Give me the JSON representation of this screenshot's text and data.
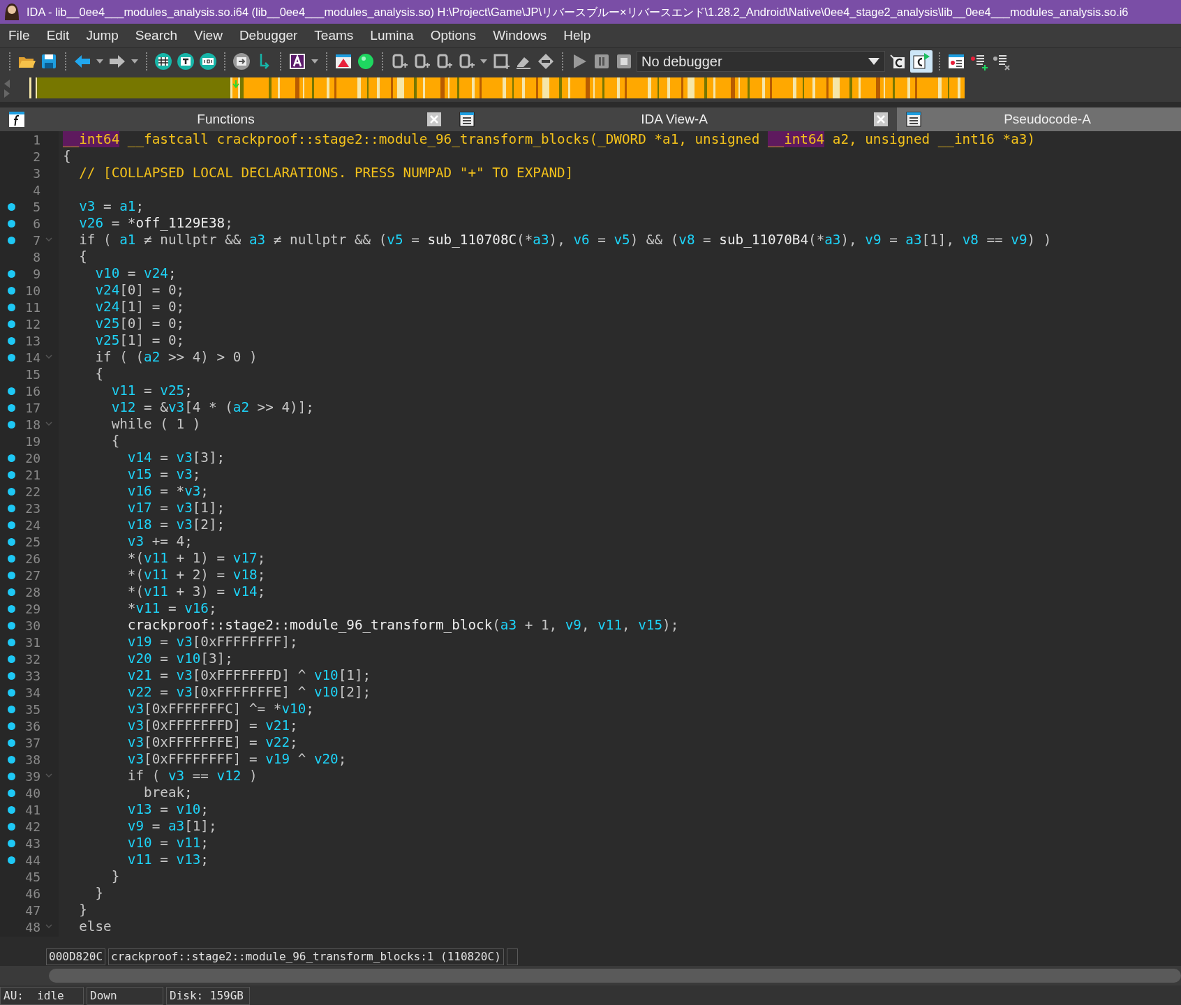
{
  "window": {
    "title": "IDA - lib__0ee4___modules_analysis.so.i64 (lib__0ee4___modules_analysis.so) H:\\Project\\Game\\JP\\リバースブルー×リバースエンド\\1.28.2_Android\\Native\\0ee4_stage2_analysis\\lib__0ee4___modules_analysis.so.i6"
  },
  "menu": [
    "File",
    "Edit",
    "Jump",
    "Search",
    "View",
    "Debugger",
    "Teams",
    "Lumina",
    "Options",
    "Windows",
    "Help"
  ],
  "toolbar": {
    "debugger_select": "No debugger",
    "sync_on": true
  },
  "tabs": [
    {
      "label": "Functions",
      "selected": false,
      "closable": true
    },
    {
      "label": "IDA View-A",
      "selected": false,
      "closable": true
    },
    {
      "label": "Pseudocode-A",
      "selected": true,
      "closable": false
    }
  ],
  "lines": [
    {
      "number": "1",
      "marker": false,
      "foldable": false,
      "tokens": [
        {
          "kind": "highlight",
          "text": "__int64"
        },
        {
          "kind": "decl",
          "text": " __fastcall crackproof::stage2::module_96_transform_blocks(_DWORD *a1, unsigned "
        },
        {
          "kind": "highlight",
          "text": "__int64"
        },
        {
          "kind": "decl",
          "text": " a2, unsigned __int16 *a3)"
        }
      ]
    },
    {
      "number": "2",
      "marker": false,
      "foldable": false,
      "tokens": [
        {
          "kind": "plain",
          "text": "{"
        }
      ]
    },
    {
      "number": "3",
      "marker": false,
      "foldable": false,
      "tokens": [
        {
          "kind": "decl",
          "text": "  // [COLLAPSED LOCAL DECLARATIONS. PRESS NUMPAD \"+\" TO EXPAND]"
        }
      ]
    },
    {
      "number": "4",
      "marker": false,
      "foldable": false
    },
    {
      "number": "5",
      "marker": true,
      "foldable": false,
      "tokens": [
        {
          "kind": "var",
          "text": "  v3"
        },
        {
          "kind": "plain",
          "text": " = "
        },
        {
          "kind": "var",
          "text": "a1"
        },
        {
          "kind": "plain",
          "text": ";"
        }
      ]
    },
    {
      "number": "6",
      "marker": true,
      "foldable": false,
      "tokens": [
        {
          "kind": "var",
          "text": "  v26"
        },
        {
          "kind": "plain",
          "text": " = *"
        },
        {
          "kind": "name",
          "text": "off_1129E38"
        },
        {
          "kind": "plain",
          "text": ";"
        }
      ]
    },
    {
      "number": "7",
      "marker": true,
      "foldable": true,
      "tokens": [
        {
          "kind": "plain",
          "text": "  if ( "
        },
        {
          "kind": "var",
          "text": "a1"
        },
        {
          "kind": "plain",
          "text": " ≠ nullptr && "
        },
        {
          "kind": "var",
          "text": "a3"
        },
        {
          "kind": "plain",
          "text": " ≠ nullptr && ("
        },
        {
          "kind": "var",
          "text": "v5"
        },
        {
          "kind": "plain",
          "text": " = "
        },
        {
          "kind": "name",
          "text": "sub_110708C"
        },
        {
          "kind": "plain",
          "text": "(*"
        },
        {
          "kind": "var",
          "text": "a3"
        },
        {
          "kind": "plain",
          "text": "), "
        },
        {
          "kind": "var",
          "text": "v6"
        },
        {
          "kind": "plain",
          "text": " = "
        },
        {
          "kind": "var",
          "text": "v5"
        },
        {
          "kind": "plain",
          "text": ") && ("
        },
        {
          "kind": "var",
          "text": "v8"
        },
        {
          "kind": "plain",
          "text": " = "
        },
        {
          "kind": "name",
          "text": "sub_11070B4"
        },
        {
          "kind": "plain",
          "text": "(*"
        },
        {
          "kind": "var",
          "text": "a3"
        },
        {
          "kind": "plain",
          "text": "), "
        },
        {
          "kind": "var",
          "text": "v9"
        },
        {
          "kind": "plain",
          "text": " = "
        },
        {
          "kind": "var",
          "text": "a3"
        },
        {
          "kind": "plain",
          "text": "[1], "
        },
        {
          "kind": "var",
          "text": "v8"
        },
        {
          "kind": "plain",
          "text": " == "
        },
        {
          "kind": "var",
          "text": "v9"
        },
        {
          "kind": "plain",
          "text": ") )"
        }
      ]
    },
    {
      "number": "8",
      "marker": false,
      "foldable": false,
      "tokens": [
        {
          "kind": "plain",
          "text": "  {"
        }
      ]
    },
    {
      "number": "9",
      "marker": true,
      "foldable": false,
      "tokens": [
        {
          "kind": "var",
          "text": "    v10"
        },
        {
          "kind": "plain",
          "text": " = "
        },
        {
          "kind": "var",
          "text": "v24"
        },
        {
          "kind": "plain",
          "text": ";"
        }
      ]
    },
    {
      "number": "10",
      "marker": true,
      "foldable": false,
      "tokens": [
        {
          "kind": "var",
          "text": "    v24"
        },
        {
          "kind": "plain",
          "text": "[0] = 0;"
        }
      ]
    },
    {
      "number": "11",
      "marker": true,
      "foldable": false,
      "tokens": [
        {
          "kind": "var",
          "text": "    v24"
        },
        {
          "kind": "plain",
          "text": "[1] = 0;"
        }
      ]
    },
    {
      "number": "12",
      "marker": true,
      "foldable": false,
      "tokens": [
        {
          "kind": "var",
          "text": "    v25"
        },
        {
          "kind": "plain",
          "text": "[0] = 0;"
        }
      ]
    },
    {
      "number": "13",
      "marker": true,
      "foldable": false,
      "tokens": [
        {
          "kind": "var",
          "text": "    v25"
        },
        {
          "kind": "plain",
          "text": "[1] = 0;"
        }
      ]
    },
    {
      "number": "14",
      "marker": true,
      "foldable": true,
      "tokens": [
        {
          "kind": "plain",
          "text": "    if ( ("
        },
        {
          "kind": "var",
          "text": "a2"
        },
        {
          "kind": "plain",
          "text": " >> 4) > 0 )"
        }
      ]
    },
    {
      "number": "15",
      "marker": false,
      "foldable": false,
      "tokens": [
        {
          "kind": "plain",
          "text": "    {"
        }
      ]
    },
    {
      "number": "16",
      "marker": true,
      "foldable": false,
      "tokens": [
        {
          "kind": "var",
          "text": "      v11"
        },
        {
          "kind": "plain",
          "text": " = "
        },
        {
          "kind": "var",
          "text": "v25"
        },
        {
          "kind": "plain",
          "text": ";"
        }
      ]
    },
    {
      "number": "17",
      "marker": true,
      "foldable": false,
      "tokens": [
        {
          "kind": "var",
          "text": "      v12"
        },
        {
          "kind": "plain",
          "text": " = &"
        },
        {
          "kind": "var",
          "text": "v3"
        },
        {
          "kind": "plain",
          "text": "[4 * ("
        },
        {
          "kind": "var",
          "text": "a2"
        },
        {
          "kind": "plain",
          "text": " >> 4)];"
        }
      ]
    },
    {
      "number": "18",
      "marker": true,
      "foldable": true,
      "tokens": [
        {
          "kind": "plain",
          "text": "      while ( 1 )"
        }
      ]
    },
    {
      "number": "19",
      "marker": false,
      "foldable": false,
      "tokens": [
        {
          "kind": "plain",
          "text": "      {"
        }
      ]
    },
    {
      "number": "20",
      "marker": true,
      "foldable": false,
      "tokens": [
        {
          "kind": "var",
          "text": "        v14"
        },
        {
          "kind": "plain",
          "text": " = "
        },
        {
          "kind": "var",
          "text": "v3"
        },
        {
          "kind": "plain",
          "text": "[3];"
        }
      ]
    },
    {
      "number": "21",
      "marker": true,
      "foldable": false,
      "tokens": [
        {
          "kind": "var",
          "text": "        v15"
        },
        {
          "kind": "plain",
          "text": " = "
        },
        {
          "kind": "var",
          "text": "v3"
        },
        {
          "kind": "plain",
          "text": ";"
        }
      ]
    },
    {
      "number": "22",
      "marker": true,
      "foldable": false,
      "tokens": [
        {
          "kind": "var",
          "text": "        v16"
        },
        {
          "kind": "plain",
          "text": " = *"
        },
        {
          "kind": "var",
          "text": "v3"
        },
        {
          "kind": "plain",
          "text": ";"
        }
      ]
    },
    {
      "number": "23",
      "marker": true,
      "foldable": false,
      "tokens": [
        {
          "kind": "var",
          "text": "        v17"
        },
        {
          "kind": "plain",
          "text": " = "
        },
        {
          "kind": "var",
          "text": "v3"
        },
        {
          "kind": "plain",
          "text": "[1];"
        }
      ]
    },
    {
      "number": "24",
      "marker": true,
      "foldable": false,
      "tokens": [
        {
          "kind": "var",
          "text": "        v18"
        },
        {
          "kind": "plain",
          "text": " = "
        },
        {
          "kind": "var",
          "text": "v3"
        },
        {
          "kind": "plain",
          "text": "[2];"
        }
      ]
    },
    {
      "number": "25",
      "marker": true,
      "foldable": false,
      "tokens": [
        {
          "kind": "var",
          "text": "        v3"
        },
        {
          "kind": "plain",
          "text": " += 4;"
        }
      ]
    },
    {
      "number": "26",
      "marker": true,
      "foldable": false,
      "tokens": [
        {
          "kind": "plain",
          "text": "        *("
        },
        {
          "kind": "var",
          "text": "v11"
        },
        {
          "kind": "plain",
          "text": " + 1) = "
        },
        {
          "kind": "var",
          "text": "v17"
        },
        {
          "kind": "plain",
          "text": ";"
        }
      ]
    },
    {
      "number": "27",
      "marker": true,
      "foldable": false,
      "tokens": [
        {
          "kind": "plain",
          "text": "        *("
        },
        {
          "kind": "var",
          "text": "v11"
        },
        {
          "kind": "plain",
          "text": " + 2) = "
        },
        {
          "kind": "var",
          "text": "v18"
        },
        {
          "kind": "plain",
          "text": ";"
        }
      ]
    },
    {
      "number": "28",
      "marker": true,
      "foldable": false,
      "tokens": [
        {
          "kind": "plain",
          "text": "        *("
        },
        {
          "kind": "var",
          "text": "v11"
        },
        {
          "kind": "plain",
          "text": " + 3) = "
        },
        {
          "kind": "var",
          "text": "v14"
        },
        {
          "kind": "plain",
          "text": ";"
        }
      ]
    },
    {
      "number": "29",
      "marker": true,
      "foldable": false,
      "tokens": [
        {
          "kind": "plain",
          "text": "        *"
        },
        {
          "kind": "var",
          "text": "v11"
        },
        {
          "kind": "plain",
          "text": " = "
        },
        {
          "kind": "var",
          "text": "v16"
        },
        {
          "kind": "plain",
          "text": ";"
        }
      ]
    },
    {
      "number": "30",
      "marker": true,
      "foldable": false,
      "tokens": [
        {
          "kind": "name",
          "text": "        crackproof::stage2::module_96_transform_block"
        },
        {
          "kind": "plain",
          "text": "("
        },
        {
          "kind": "var",
          "text": "a3"
        },
        {
          "kind": "plain",
          "text": " + 1, "
        },
        {
          "kind": "var",
          "text": "v9"
        },
        {
          "kind": "plain",
          "text": ", "
        },
        {
          "kind": "var",
          "text": "v11"
        },
        {
          "kind": "plain",
          "text": ", "
        },
        {
          "kind": "var",
          "text": "v15"
        },
        {
          "kind": "plain",
          "text": ");"
        }
      ]
    },
    {
      "number": "31",
      "marker": true,
      "foldable": false,
      "tokens": [
        {
          "kind": "var",
          "text": "        v19"
        },
        {
          "kind": "plain",
          "text": " = "
        },
        {
          "kind": "var",
          "text": "v3"
        },
        {
          "kind": "plain",
          "text": "[0xFFFFFFFF];"
        }
      ]
    },
    {
      "number": "32",
      "marker": true,
      "foldable": false,
      "tokens": [
        {
          "kind": "var",
          "text": "        v20"
        },
        {
          "kind": "plain",
          "text": " = "
        },
        {
          "kind": "var",
          "text": "v10"
        },
        {
          "kind": "plain",
          "text": "[3];"
        }
      ]
    },
    {
      "number": "33",
      "marker": true,
      "foldable": false,
      "tokens": [
        {
          "kind": "var",
          "text": "        v21"
        },
        {
          "kind": "plain",
          "text": " = "
        },
        {
          "kind": "var",
          "text": "v3"
        },
        {
          "kind": "plain",
          "text": "[0xFFFFFFFD] ^ "
        },
        {
          "kind": "var",
          "text": "v10"
        },
        {
          "kind": "plain",
          "text": "[1];"
        }
      ]
    },
    {
      "number": "34",
      "marker": true,
      "foldable": false,
      "tokens": [
        {
          "kind": "var",
          "text": "        v22"
        },
        {
          "kind": "plain",
          "text": " = "
        },
        {
          "kind": "var",
          "text": "v3"
        },
        {
          "kind": "plain",
          "text": "[0xFFFFFFFE] ^ "
        },
        {
          "kind": "var",
          "text": "v10"
        },
        {
          "kind": "plain",
          "text": "[2];"
        }
      ]
    },
    {
      "number": "35",
      "marker": true,
      "foldable": false,
      "tokens": [
        {
          "kind": "var",
          "text": "        v3"
        },
        {
          "kind": "plain",
          "text": "[0xFFFFFFFC] ^= *"
        },
        {
          "kind": "var",
          "text": "v10"
        },
        {
          "kind": "plain",
          "text": ";"
        }
      ]
    },
    {
      "number": "36",
      "marker": true,
      "foldable": false,
      "tokens": [
        {
          "kind": "var",
          "text": "        v3"
        },
        {
          "kind": "plain",
          "text": "[0xFFFFFFFD] = "
        },
        {
          "kind": "var",
          "text": "v21"
        },
        {
          "kind": "plain",
          "text": ";"
        }
      ]
    },
    {
      "number": "37",
      "marker": true,
      "foldable": false,
      "tokens": [
        {
          "kind": "var",
          "text": "        v3"
        },
        {
          "kind": "plain",
          "text": "[0xFFFFFFFE] = "
        },
        {
          "kind": "var",
          "text": "v22"
        },
        {
          "kind": "plain",
          "text": ";"
        }
      ]
    },
    {
      "number": "38",
      "marker": true,
      "foldable": false,
      "tokens": [
        {
          "kind": "var",
          "text": "        v3"
        },
        {
          "kind": "plain",
          "text": "[0xFFFFFFFF] = "
        },
        {
          "kind": "var",
          "text": "v19"
        },
        {
          "kind": "plain",
          "text": " ^ "
        },
        {
          "kind": "var",
          "text": "v20"
        },
        {
          "kind": "plain",
          "text": ";"
        }
      ]
    },
    {
      "number": "39",
      "marker": true,
      "foldable": true,
      "tokens": [
        {
          "kind": "plain",
          "text": "        if ( "
        },
        {
          "kind": "var",
          "text": "v3"
        },
        {
          "kind": "plain",
          "text": " == "
        },
        {
          "kind": "var",
          "text": "v12"
        },
        {
          "kind": "plain",
          "text": " )"
        }
      ]
    },
    {
      "number": "40",
      "marker": true,
      "foldable": false,
      "tokens": [
        {
          "kind": "plain",
          "text": "          break;"
        }
      ]
    },
    {
      "number": "41",
      "marker": true,
      "foldable": false,
      "tokens": [
        {
          "kind": "var",
          "text": "        v13"
        },
        {
          "kind": "plain",
          "text": " = "
        },
        {
          "kind": "var",
          "text": "v10"
        },
        {
          "kind": "plain",
          "text": ";"
        }
      ]
    },
    {
      "number": "42",
      "marker": true,
      "foldable": false,
      "tokens": [
        {
          "kind": "var",
          "text": "        v9"
        },
        {
          "kind": "plain",
          "text": " = "
        },
        {
          "kind": "var",
          "text": "a3"
        },
        {
          "kind": "plain",
          "text": "[1];"
        }
      ]
    },
    {
      "number": "43",
      "marker": true,
      "foldable": false,
      "tokens": [
        {
          "kind": "var",
          "text": "        v10"
        },
        {
          "kind": "plain",
          "text": " = "
        },
        {
          "kind": "var",
          "text": "v11"
        },
        {
          "kind": "plain",
          "text": ";"
        }
      ]
    },
    {
      "number": "44",
      "marker": true,
      "foldable": false,
      "tokens": [
        {
          "kind": "var",
          "text": "        v11"
        },
        {
          "kind": "plain",
          "text": " = "
        },
        {
          "kind": "var",
          "text": "v13"
        },
        {
          "kind": "plain",
          "text": ";"
        }
      ]
    },
    {
      "number": "45",
      "marker": false,
      "foldable": false,
      "tokens": [
        {
          "kind": "plain",
          "text": "      }"
        }
      ]
    },
    {
      "number": "46",
      "marker": false,
      "foldable": false,
      "tokens": [
        {
          "kind": "plain",
          "text": "    }"
        }
      ]
    },
    {
      "number": "47",
      "marker": false,
      "foldable": false,
      "tokens": [
        {
          "kind": "plain",
          "text": "  }"
        }
      ]
    },
    {
      "number": "48",
      "marker": false,
      "foldable": true,
      "tokens": [
        {
          "kind": "plain",
          "text": "  else"
        }
      ]
    }
  ],
  "location_bar": {
    "address": "000D820C",
    "function": "crackproof::stage2::module_96_transform_blocks:1 (110820C)"
  },
  "status_bar": [
    "AU:  idle",
    "Down",
    "Disk: 159GB"
  ]
}
